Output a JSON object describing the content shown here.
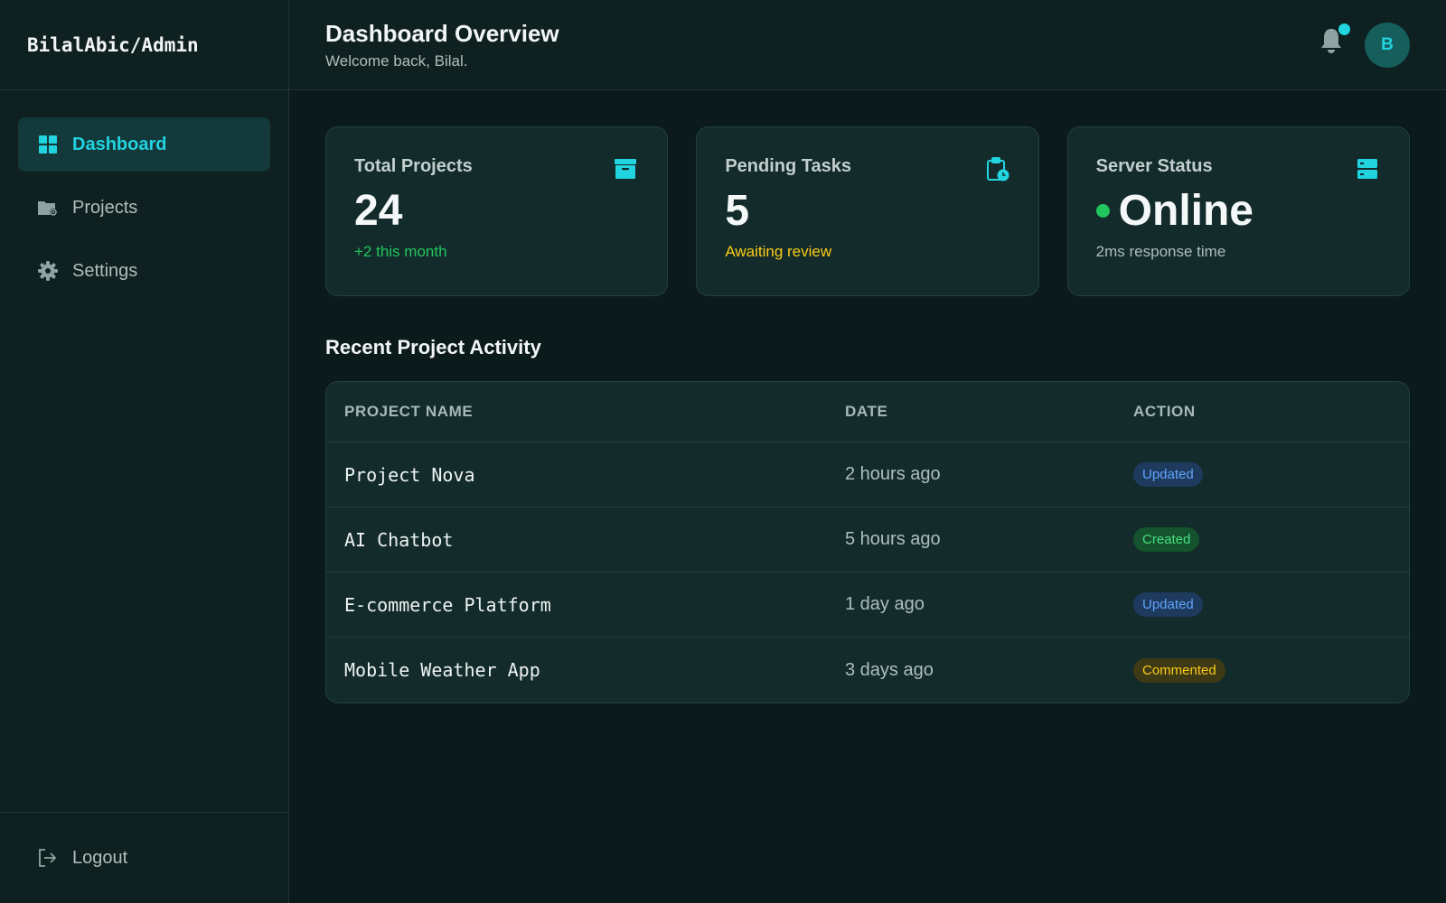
{
  "brand": "BilalAbic/Admin",
  "nav": [
    {
      "label": "Dashboard",
      "icon": "grid-icon",
      "active": true
    },
    {
      "label": "Projects",
      "icon": "folder-gear-icon",
      "active": false
    },
    {
      "label": "Settings",
      "icon": "gear-icon",
      "active": false
    }
  ],
  "logout_label": "Logout",
  "header": {
    "title": "Dashboard Overview",
    "subtitle": "Welcome back, Bilal.",
    "avatar_initial": "B"
  },
  "cards": [
    {
      "label": "Total Projects",
      "value": "24",
      "note": "+2 this month",
      "note_color": "#22c55e",
      "icon": "archive-icon"
    },
    {
      "label": "Pending Tasks",
      "value": "5",
      "note": "Awaiting review",
      "note_color": "#facc15",
      "icon": "clipboard-clock-icon"
    },
    {
      "label": "Server Status",
      "value": "Online",
      "note": "2ms response time",
      "note_color": "#aebebd",
      "icon": "server-icon"
    }
  ],
  "activity": {
    "title": "Recent Project Activity",
    "columns": [
      "PROJECT NAME",
      "DATE",
      "ACTION"
    ],
    "rows": [
      {
        "name": "Project Nova",
        "date": "2 hours ago",
        "action": "Updated"
      },
      {
        "name": "AI Chatbot",
        "date": "5 hours ago",
        "action": "Created"
      },
      {
        "name": "E-commerce Platform",
        "date": "1 day ago",
        "action": "Updated"
      },
      {
        "name": "Mobile Weather App",
        "date": "3 days ago",
        "action": "Commented"
      }
    ]
  },
  "colors": {
    "accent": "#22d3e0",
    "online": "#22c55e",
    "badge_updated_bg": "#1e3a5f",
    "badge_updated_fg": "#60a5fa",
    "badge_created_bg": "#14532d",
    "badge_created_fg": "#4ade80",
    "badge_commented_bg": "#3f3a16",
    "badge_commented_fg": "#facc15"
  }
}
